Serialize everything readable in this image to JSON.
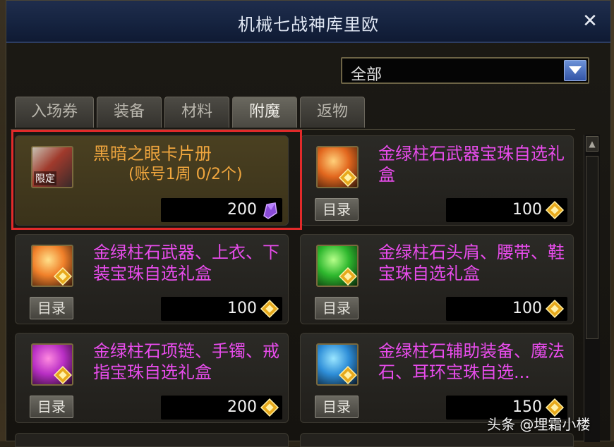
{
  "window": {
    "title": "机械七战神库里欧"
  },
  "filter": {
    "selected": "全部"
  },
  "tabs": [
    {
      "label": "入场券"
    },
    {
      "label": "装备"
    },
    {
      "label": "材料"
    },
    {
      "label": "附魔",
      "active": true
    },
    {
      "label": "返物"
    }
  ],
  "items": [
    {
      "name": "黑暗之眼卡片册",
      "subtitle": "(账号1周 0/2个)",
      "price": "200",
      "badge": "限定",
      "currency_icon": "purple-crystal-icon"
    },
    {
      "name": "金绿柱石武器宝珠自选礼盒",
      "price": "100",
      "catalog_label": "目录",
      "currency_icon": "gold-coin-icon"
    },
    {
      "name": "金绿柱石武器、上衣、下装宝珠自选礼盒",
      "price": "100",
      "catalog_label": "目录",
      "currency_icon": "gold-coin-icon"
    },
    {
      "name": "金绿柱石头肩、腰带、鞋宝珠自选礼盒",
      "price": "100",
      "catalog_label": "目录",
      "currency_icon": "gold-coin-icon"
    },
    {
      "name": "金绿柱石项链、手镯、戒指宝珠自选礼盒",
      "price": "200",
      "catalog_label": "目录",
      "currency_icon": "gold-coin-icon"
    },
    {
      "name": "金绿柱石辅助装备、魔法石、耳环宝珠自选...",
      "price": "150",
      "catalog_label": "目录",
      "currency_icon": "gold-coin-icon"
    }
  ],
  "watermark": "头条 @埋霜小楼",
  "colors": {
    "accent_magenta": "#e84cec",
    "accent_orange": "#f0a63e",
    "highlight_red": "#e22a2a"
  }
}
